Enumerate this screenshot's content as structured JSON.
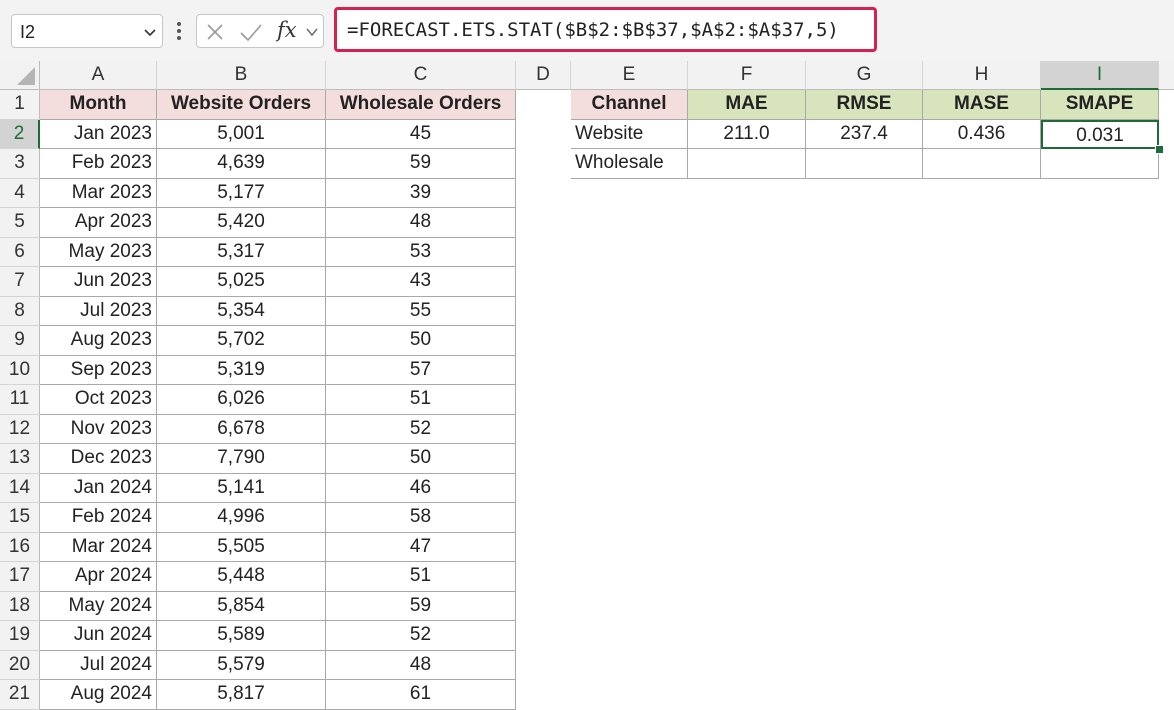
{
  "formula_bar": {
    "name_box": "I2",
    "formula": "=FORECAST.ETS.STAT($B$2:$B$37,$A$2:$A$37,5)",
    "icons": [
      "chevron-down-icon",
      "vertical-dots-icon",
      "cancel-x-icon",
      "enter-check-icon",
      "fx-icon"
    ]
  },
  "columns": [
    "A",
    "B",
    "C",
    "D",
    "E",
    "F",
    "G",
    "H",
    "I"
  ],
  "row_numbers": [
    "1",
    "2",
    "3",
    "4",
    "5",
    "6",
    "7",
    "8",
    "9",
    "10",
    "11",
    "12",
    "13",
    "14",
    "15",
    "16",
    "17",
    "18",
    "19",
    "20",
    "21"
  ],
  "data_table": {
    "headers": [
      "Month",
      "Website Orders",
      "Wholesale Orders"
    ],
    "rows": [
      [
        "Jan 2023",
        "5,001",
        "45"
      ],
      [
        "Feb 2023",
        "4,639",
        "59"
      ],
      [
        "Mar 2023",
        "5,177",
        "39"
      ],
      [
        "Apr 2023",
        "5,420",
        "48"
      ],
      [
        "May 2023",
        "5,317",
        "53"
      ],
      [
        "Jun 2023",
        "5,025",
        "43"
      ],
      [
        "Jul 2023",
        "5,354",
        "55"
      ],
      [
        "Aug 2023",
        "5,702",
        "50"
      ],
      [
        "Sep 2023",
        "5,319",
        "57"
      ],
      [
        "Oct 2023",
        "6,026",
        "51"
      ],
      [
        "Nov 2023",
        "6,678",
        "52"
      ],
      [
        "Dec 2023",
        "7,790",
        "50"
      ],
      [
        "Jan 2024",
        "5,141",
        "46"
      ],
      [
        "Feb 2024",
        "4,996",
        "58"
      ],
      [
        "Mar 2024",
        "5,505",
        "47"
      ],
      [
        "Apr 2024",
        "5,448",
        "51"
      ],
      [
        "May 2024",
        "5,854",
        "59"
      ],
      [
        "Jun 2024",
        "5,589",
        "52"
      ],
      [
        "Jul 2024",
        "5,579",
        "48"
      ],
      [
        "Aug 2024",
        "5,817",
        "61"
      ]
    ]
  },
  "stats_table": {
    "headers": [
      "Channel",
      "MAE",
      "RMSE",
      "MASE",
      "SMAPE"
    ],
    "rows": [
      [
        "Website",
        "211.0",
        "237.4",
        "0.436",
        "0.031"
      ],
      [
        "Wholesale",
        "",
        "",
        "",
        ""
      ]
    ]
  },
  "colors": {
    "formula_highlight": "#d6204e",
    "selection": "#1e6b3a",
    "header_pink": "#f4dddd",
    "header_green": "#d8e4bc"
  }
}
